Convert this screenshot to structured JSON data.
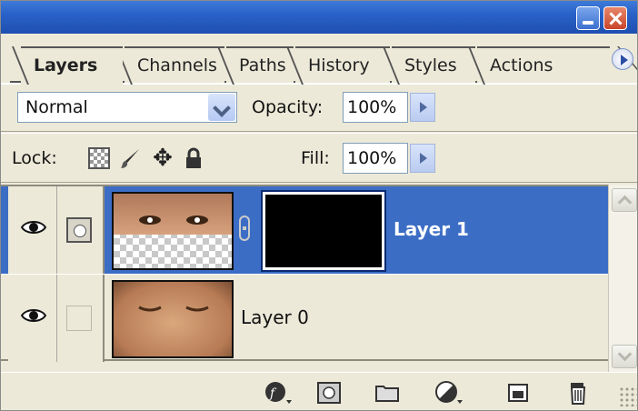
{
  "tabs": [
    {
      "label": "Layers",
      "active": true
    },
    {
      "label": "Channels",
      "active": false
    },
    {
      "label": "Paths",
      "active": false
    },
    {
      "label": "History",
      "active": false
    },
    {
      "label": "Styles",
      "active": false
    },
    {
      "label": "Actions",
      "active": false
    }
  ],
  "blend": {
    "mode": "Normal"
  },
  "opacity": {
    "label": "Opacity:",
    "value": "100%"
  },
  "lock": {
    "label": "Lock:"
  },
  "fill": {
    "label": "Fill:",
    "value": "100%"
  },
  "layers": [
    {
      "name": "Layer 1",
      "selected": true,
      "visible": true,
      "has_mask": true
    },
    {
      "name": "Layer 0",
      "selected": false,
      "visible": true,
      "has_mask": false
    }
  ],
  "colors": {
    "selection": "#3c6dc5",
    "panel": "#ece9d8",
    "titlebar": "#2a62c8"
  },
  "icons": [
    "eye-icon",
    "layer-mask-indicator-icon",
    "chain-link-icon",
    "lock-transparent-icon",
    "lock-paint-icon",
    "lock-move-icon",
    "lock-all-icon",
    "layer-style-icon",
    "add-mask-icon",
    "new-group-icon",
    "adjustment-layer-icon",
    "new-layer-icon",
    "trash-icon"
  ]
}
